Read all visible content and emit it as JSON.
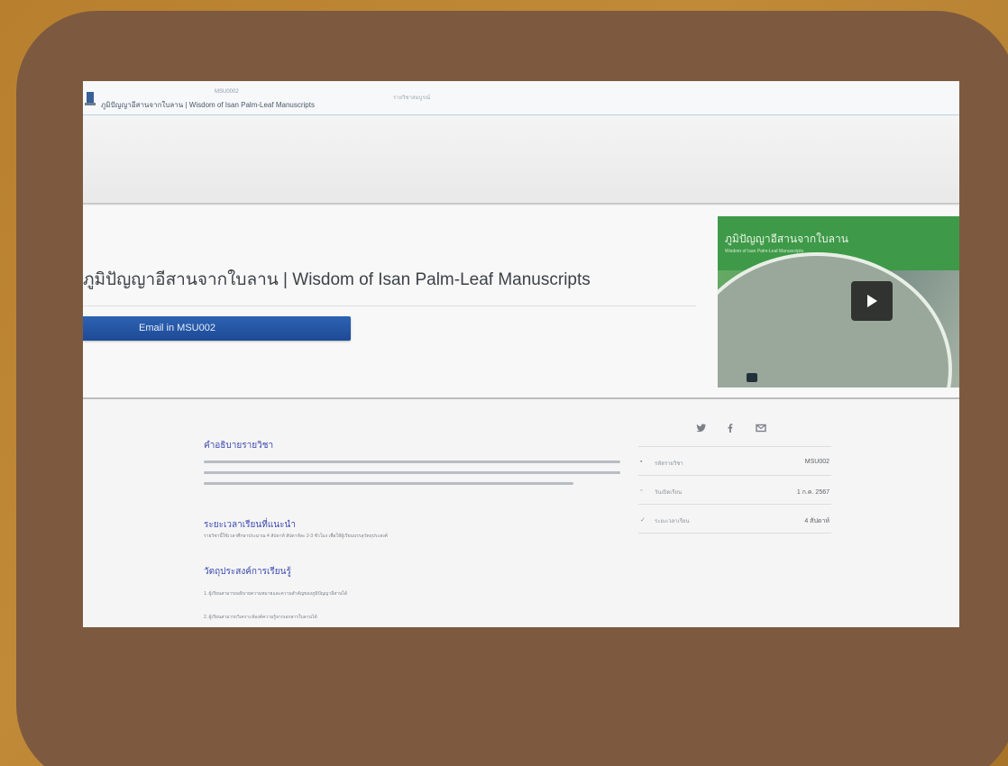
{
  "header": {
    "site_title": "ภูมิปัญญาอีสานจากใบลาน | Wisdom of Isan Palm-Leaf Manuscripts",
    "crumb_code": "MSU0002",
    "crumb_sub": "รายวิชาสมบูรณ์"
  },
  "hero": {
    "course_title": "ภูมิปัญญาอีสานจากใบลาน | Wisdom of Isan Palm-Leaf Manuscripts",
    "enroll_label": "Email in MSU002"
  },
  "video": {
    "title": "ภูมิปัญญาอีสานจากใบลาน",
    "subtitle": "Wisdom of Isan Palm-Leaf Manuscripts",
    "icon": "play-icon"
  },
  "content": {
    "about_heading": "คำอธิบายรายวิชา",
    "schedule_heading": "ระยะเวลาเรียนที่แนะนำ",
    "schedule_text": "รายวิชานี้ใช้เวลาศึกษาประมาณ 4 สัปดาห์ สัปดาห์ละ 2-3 ชั่วโมง เพื่อให้ผู้เรียนบรรลุวัตถุประสงค์",
    "objectives_heading": "วัตถุประสงค์การเรียนรู้",
    "objective_1": "1. ผู้เรียนสามารถอธิบายความหมายและความสำคัญของภูมิปัญญาอีสานได้",
    "objective_2": "2. ผู้เรียนสามารถวิเคราะห์องค์ความรู้จากเอกสารใบลานได้"
  },
  "share": {
    "icons": [
      "twitter-icon",
      "facebook-icon",
      "email-icon"
    ]
  },
  "info": {
    "rows": [
      {
        "icon": "course-code-icon",
        "label": "รหัสรายวิชา",
        "value": "MSU002"
      },
      {
        "icon": "calendar-icon",
        "label": "วันเปิดเรียน",
        "value": "1 ก.ค. 2567"
      },
      {
        "icon": "clock-icon",
        "label": "ระยะเวลาเรียน",
        "value": "4 สัปดาห์"
      }
    ]
  },
  "colors": {
    "background": "#b8802e",
    "panel": "#7d5a3f",
    "accent_blue": "#1e4a95",
    "heading_blue": "#3b49b0",
    "video_green": "#3e9a48"
  }
}
